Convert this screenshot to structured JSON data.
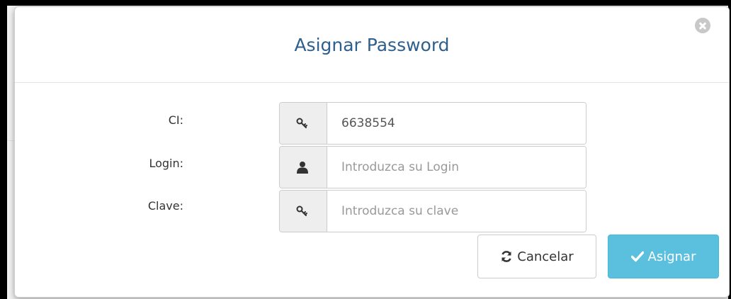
{
  "modal": {
    "title": "Asignar Password"
  },
  "form": {
    "ci": {
      "label": "CI:",
      "value": "6638554",
      "placeholder": "",
      "icon": "key-icon"
    },
    "login": {
      "label": "Login:",
      "value": "",
      "placeholder": "Introduzca su Login",
      "icon": "user-icon"
    },
    "clave": {
      "label": "Clave:",
      "value": "",
      "placeholder": "Introduzca su clave",
      "icon": "key-icon"
    }
  },
  "buttons": {
    "cancel_label": "Cancelar",
    "cancel_icon": "refresh-icon",
    "assign_label": "Asignar",
    "assign_icon": "check-icon"
  },
  "colors": {
    "title": "#2f5f8c",
    "assign_button": "#5bc0de",
    "addon": "#eeeeee"
  }
}
